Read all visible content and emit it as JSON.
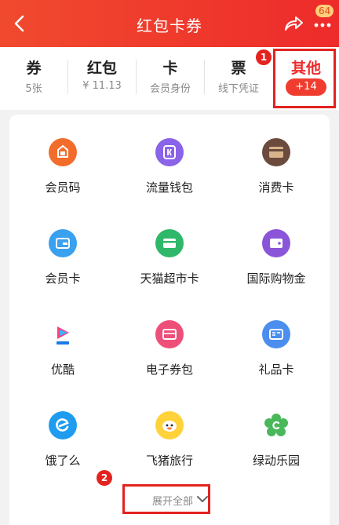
{
  "header": {
    "title": "红包卡券",
    "more_badge": "64"
  },
  "categories": [
    {
      "name": "券",
      "sub": "5张"
    },
    {
      "name": "红包",
      "sub": "¥ 11.13"
    },
    {
      "name": "卡",
      "sub": "会员身份"
    },
    {
      "name": "票",
      "sub": "线下凭证"
    },
    {
      "name": "其他",
      "sub": "+14"
    }
  ],
  "annotations": {
    "mark1": "1",
    "mark2": "2"
  },
  "grid": [
    {
      "label": "会员码",
      "icon": "member-code-icon",
      "color": "#f26c2b"
    },
    {
      "label": "流量钱包",
      "icon": "data-wallet-icon",
      "color": "#8a63e8"
    },
    {
      "label": "消费卡",
      "icon": "consumption-card-icon",
      "color": "#6b4b3d"
    },
    {
      "label": "会员卡",
      "icon": "vip-card-icon",
      "color": "#3aa0f0"
    },
    {
      "label": "天猫超市卡",
      "icon": "tmall-card-icon",
      "color": "#2fb86a"
    },
    {
      "label": "国际购物金",
      "icon": "wallet-icon",
      "color": "#8a55d8"
    },
    {
      "label": "优酷",
      "icon": "youku-icon",
      "color": "#ffffff"
    },
    {
      "label": "电子券包",
      "icon": "coupon-pack-icon",
      "color": "#ee4f78"
    },
    {
      "label": "礼品卡",
      "icon": "gift-card-icon",
      "color": "#4b8ef0"
    },
    {
      "label": "饿了么",
      "icon": "eleme-icon",
      "color": "#1f9cf0"
    },
    {
      "label": "飞猪旅行",
      "icon": "fliggy-icon",
      "color": "#ffd23a"
    },
    {
      "label": "绿动乐园",
      "icon": "green-park-icon",
      "color": "#49b85a"
    }
  ],
  "expand": {
    "label": "展开全部"
  },
  "colors": {
    "accent": "#ee2b2b",
    "highlight": "#e3231f"
  }
}
